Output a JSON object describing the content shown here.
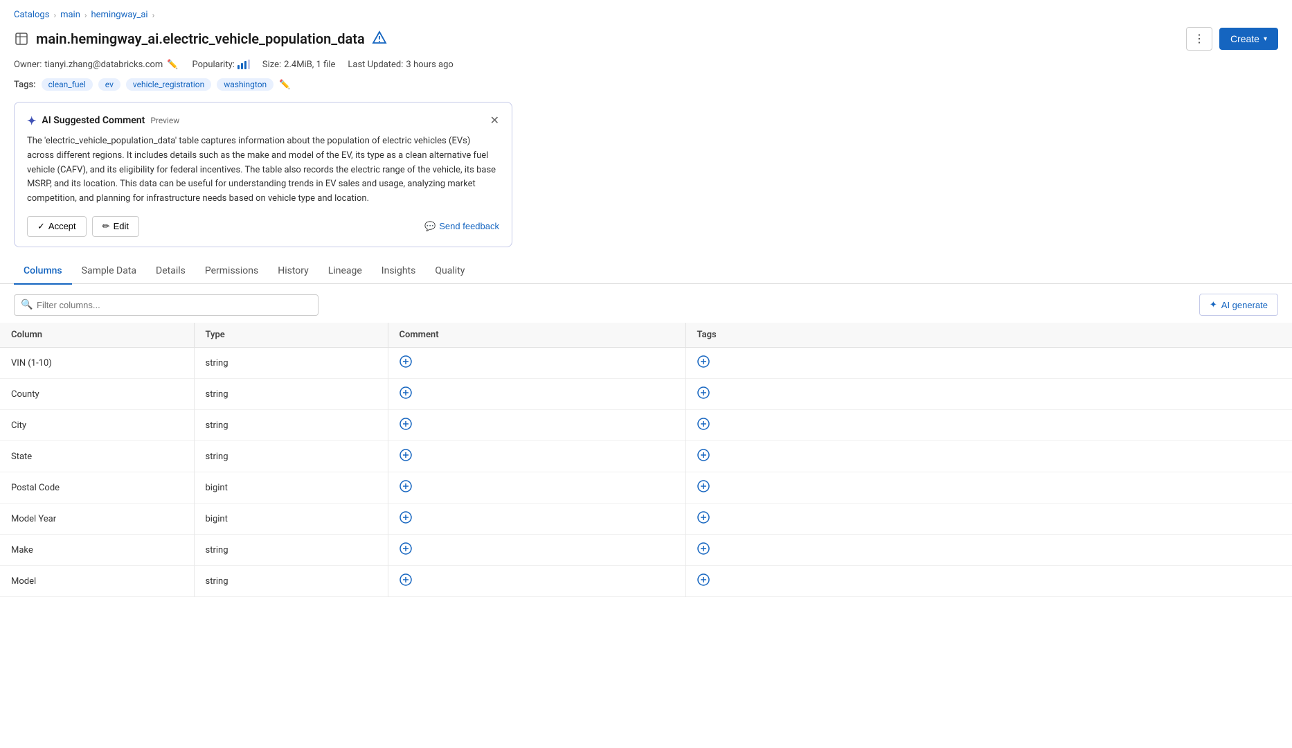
{
  "breadcrumb": {
    "items": [
      "Catalogs",
      "main",
      "hemingway_ai"
    ],
    "separators": [
      ">",
      ">",
      ">"
    ]
  },
  "title": {
    "text": "main.hemingway_ai.electric_vehicle_population_data",
    "icon": "table-icon",
    "alert_icon": "unity-alert"
  },
  "meta": {
    "owner_label": "Owner:",
    "owner_value": "tianyi.zhang@databricks.com",
    "popularity_label": "Popularity:",
    "size_label": "Size:",
    "size_value": "2.4MiB, 1 file",
    "updated_label": "Last Updated:",
    "updated_value": "3 hours ago"
  },
  "tags": {
    "label": "Tags:",
    "items": [
      "clean_fuel",
      "ev",
      "vehicle_registration",
      "washington"
    ]
  },
  "ai_card": {
    "title": "AI Suggested Comment",
    "badge": "Preview",
    "body": "The 'electric_vehicle_population_data' table captures information about the population of electric vehicles (EVs) across different regions. It includes details such as the make and model of the EV, its type as a clean alternative fuel vehicle (CAFV), and its eligibility for federal incentives. The table also records the electric range of the vehicle, its base MSRP, and its location. This data can be useful for understanding trends in EV sales and usage, analyzing market competition, and planning for infrastructure needs based on vehicle type and location.",
    "accept_label": "Accept",
    "edit_label": "Edit",
    "feedback_label": "Send feedback"
  },
  "tabs": {
    "items": [
      "Columns",
      "Sample Data",
      "Details",
      "Permissions",
      "History",
      "Lineage",
      "Insights",
      "Quality"
    ],
    "active": "Columns"
  },
  "filter": {
    "placeholder": "Filter columns..."
  },
  "ai_generate": {
    "label": "AI generate"
  },
  "table": {
    "headers": [
      "Column",
      "Type",
      "Comment",
      "Tags"
    ],
    "rows": [
      {
        "column": "VIN (1-10)",
        "type": "string"
      },
      {
        "column": "County",
        "type": "string"
      },
      {
        "column": "City",
        "type": "string"
      },
      {
        "column": "State",
        "type": "string"
      },
      {
        "column": "Postal Code",
        "type": "bigint"
      },
      {
        "column": "Model Year",
        "type": "bigint"
      },
      {
        "column": "Make",
        "type": "string"
      },
      {
        "column": "Model",
        "type": "string"
      }
    ]
  },
  "buttons": {
    "more": "⋮",
    "create": "Create",
    "create_chevron": "▾"
  },
  "colors": {
    "accent": "#1565c0",
    "border": "#e0e0e0",
    "tag_bg": "#e8f0fe",
    "card_border": "#c5cae9"
  }
}
